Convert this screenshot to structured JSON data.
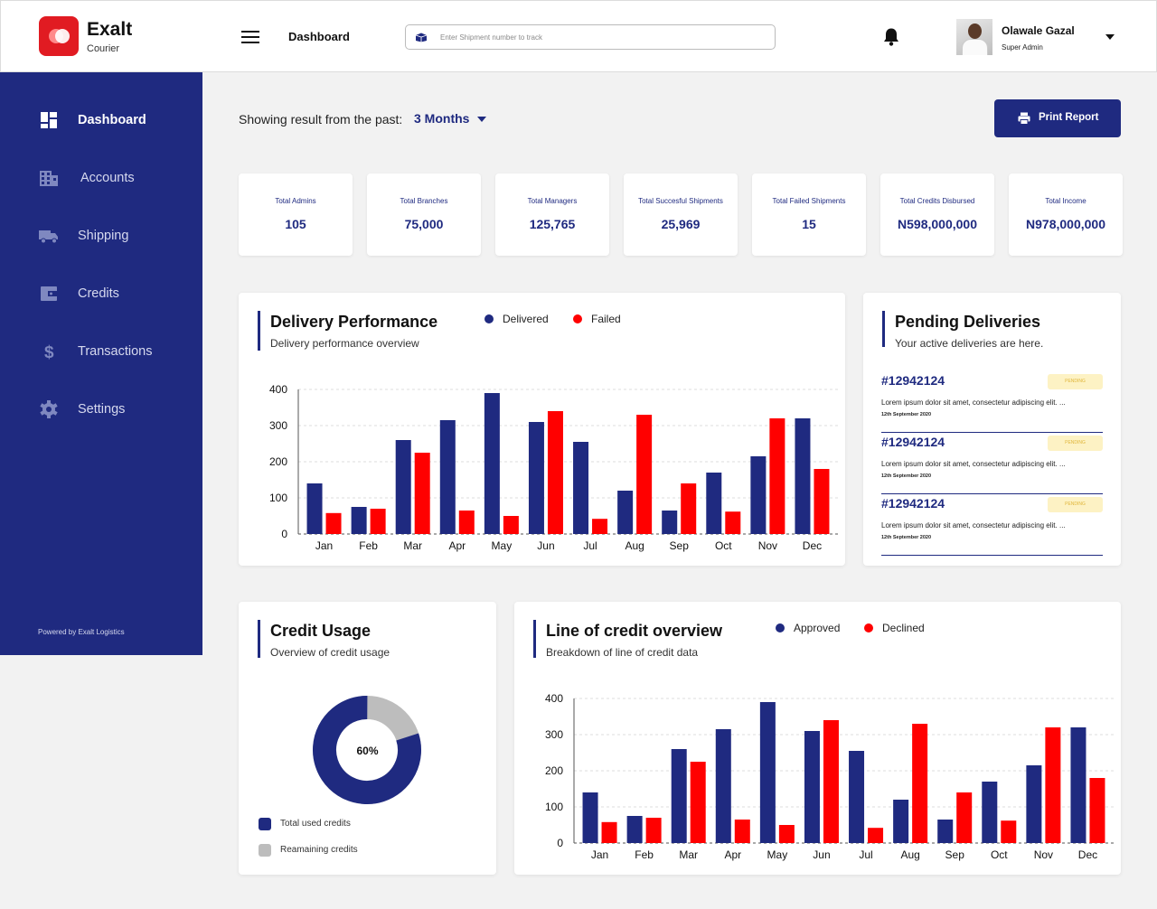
{
  "brand": {
    "name": "Exalt",
    "sub": "Courier"
  },
  "header": {
    "title": "Dashboard",
    "search_placeholder": "Enter Shipment number to track",
    "user_name": "Olawale Gazal",
    "user_role": "Super Admin"
  },
  "sidebar": {
    "items": [
      {
        "label": "Dashboard",
        "icon": "dashboard-icon"
      },
      {
        "label": "Accounts",
        "icon": "building-icon"
      },
      {
        "label": "Shipping",
        "icon": "truck-icon"
      },
      {
        "label": "Credits",
        "icon": "wallet-icon"
      },
      {
        "label": "Transactions",
        "icon": "dollar-icon"
      },
      {
        "label": "Settings",
        "icon": "gear-icon"
      }
    ],
    "powered_by": "Powered by Exalt Logistics"
  },
  "filter": {
    "label": "Showing result from the past:",
    "value": "3 Months"
  },
  "print_label": "Print Report",
  "stats": [
    {
      "label": "Total Admins",
      "value": "105"
    },
    {
      "label": "Total Branches",
      "value": "75,000"
    },
    {
      "label": "Total Managers",
      "value": "125,765"
    },
    {
      "label": "Total Succesful Shipments",
      "value": "25,969"
    },
    {
      "label": "Total Failed Shipments",
      "value": "15"
    },
    {
      "label": "Total Credits Disbursed",
      "value": "N598,000,000"
    },
    {
      "label": "Total Income",
      "value": "N978,000,000"
    }
  ],
  "delivery": {
    "title": "Delivery Performance",
    "subtitle": "Delivery performance overview",
    "legend": [
      "Delivered",
      "Failed"
    ]
  },
  "pending": {
    "title": "Pending Deliveries",
    "subtitle": "Your active deliveries are here.",
    "items": [
      {
        "id": "#12942124",
        "status": "PENDING",
        "desc": "Lorem ipsum dolor sit amet, consectetur adipiscing elit. ...",
        "date": "12th September 2020"
      },
      {
        "id": "#12942124",
        "status": "PENDING",
        "desc": "Lorem ipsum dolor sit amet, consectetur adipiscing elit. ...",
        "date": "12th September 2020"
      },
      {
        "id": "#12942124",
        "status": "PENDING",
        "desc": "Lorem ipsum dolor sit amet, consectetur adipiscing elit. ...",
        "date": "12th September 2020"
      }
    ]
  },
  "credit_usage": {
    "title": "Credit Usage",
    "subtitle": "Overview of credit usage",
    "center_label": "60%",
    "used_fraction": 0.8,
    "legend": [
      "Total used credits",
      "Reamaining credits"
    ],
    "colors": {
      "used": "#1f2a80",
      "remaining": "#bdbdbd"
    }
  },
  "line_credit": {
    "title": "Line of credit overview",
    "subtitle": "Breakdown of line of credit data",
    "legend": [
      "Approved",
      "Declined"
    ]
  },
  "colors": {
    "primary": "#1f2a80",
    "accent": "#ff0000",
    "brand": "#e11b22"
  },
  "chart_data": [
    {
      "type": "bar",
      "categories": [
        "Jan",
        "Feb",
        "Mar",
        "Apr",
        "May",
        "Jun",
        "Jul",
        "Aug",
        "Sep",
        "Oct",
        "Nov",
        "Dec"
      ],
      "series": [
        {
          "name": "Delivered",
          "color": "#1f2a80",
          "values": [
            140,
            75,
            260,
            315,
            390,
            310,
            255,
            120,
            65,
            170,
            215,
            320
          ]
        },
        {
          "name": "Failed",
          "color": "#ff0000",
          "values": [
            58,
            70,
            225,
            65,
            50,
            340,
            42,
            330,
            140,
            62,
            320,
            180
          ]
        }
      ],
      "yticks": [
        0,
        100,
        200,
        300,
        400
      ],
      "ylim": [
        0,
        400
      ],
      "grid": true
    },
    {
      "type": "bar",
      "categories": [
        "Jan",
        "Feb",
        "Mar",
        "Apr",
        "May",
        "Jun",
        "Jul",
        "Aug",
        "Sep",
        "Oct",
        "Nov",
        "Dec"
      ],
      "series": [
        {
          "name": "Approved",
          "color": "#1f2a80",
          "values": [
            140,
            75,
            260,
            315,
            390,
            310,
            255,
            120,
            65,
            170,
            215,
            320
          ]
        },
        {
          "name": "Declined",
          "color": "#ff0000",
          "values": [
            58,
            70,
            225,
            65,
            50,
            340,
            42,
            330,
            140,
            62,
            320,
            180
          ]
        }
      ],
      "yticks": [
        0,
        100,
        200,
        300,
        400
      ],
      "ylim": [
        0,
        400
      ],
      "grid": true
    }
  ]
}
